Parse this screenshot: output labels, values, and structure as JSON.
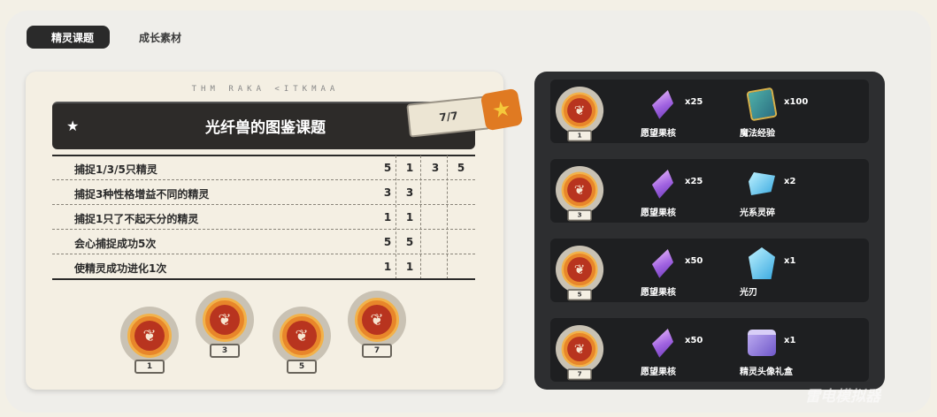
{
  "tabs": [
    {
      "label": "精灵课题",
      "active": true
    },
    {
      "label": "成长素材",
      "active": false
    }
  ],
  "quest": {
    "runes": "THM RAKA <ITKMAA",
    "title": "光纤兽的图鉴课题",
    "progress": "7/7",
    "tasks": [
      {
        "label": "捕捉1/3/5只精灵",
        "cells": [
          "5",
          "1",
          "3",
          "5"
        ]
      },
      {
        "label": "捕捉3种性格增益不同的精灵",
        "cells": [
          "3",
          "3",
          "",
          ""
        ]
      },
      {
        "label": "捕捉1只了不起天分的精灵",
        "cells": [
          "1",
          "1",
          "",
          ""
        ]
      },
      {
        "label": "会心捕捉成功5次",
        "cells": [
          "5",
          "5",
          "",
          ""
        ]
      },
      {
        "label": "使精灵成功进化1次",
        "cells": [
          "1",
          "1",
          "",
          ""
        ]
      }
    ],
    "medals": [
      "1",
      "3",
      "5",
      "7"
    ]
  },
  "rewards": [
    {
      "level": "1",
      "items": [
        {
          "name": "愿望果核",
          "qty": "x25",
          "icon": "crystal-icon"
        },
        {
          "name": "魔法经验",
          "qty": "x100",
          "icon": "book-icon"
        }
      ]
    },
    {
      "level": "3",
      "items": [
        {
          "name": "愿望果核",
          "qty": "x25",
          "icon": "crystal-icon"
        },
        {
          "name": "光系灵碎",
          "qty": "x2",
          "icon": "shard-icon"
        }
      ]
    },
    {
      "level": "5",
      "items": [
        {
          "name": "愿望果核",
          "qty": "x50",
          "icon": "crystal-icon"
        },
        {
          "name": "光刃",
          "qty": "x1",
          "icon": "blade-icon"
        }
      ]
    },
    {
      "level": "7",
      "items": [
        {
          "name": "愿望果核",
          "qty": "x50",
          "icon": "crystal-icon"
        },
        {
          "name": "精灵头像礼盒",
          "qty": "x1",
          "icon": "gift-box-icon"
        }
      ]
    }
  ],
  "watermark": "雷电模拟器"
}
